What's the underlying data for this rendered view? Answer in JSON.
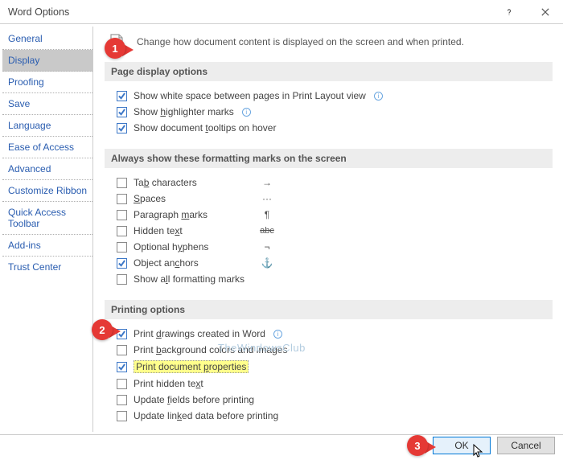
{
  "title": "Word Options",
  "header": "Change how document content is displayed on the screen and when printed.",
  "sidebar": {
    "items": [
      {
        "label": "General"
      },
      {
        "label": "Display"
      },
      {
        "label": "Proofing"
      },
      {
        "label": "Save"
      },
      {
        "label": "Language"
      },
      {
        "label": "Ease of Access"
      },
      {
        "label": "Advanced"
      },
      {
        "label": "Customize Ribbon"
      },
      {
        "label": "Quick Access Toolbar"
      },
      {
        "label": "Add-ins"
      },
      {
        "label": "Trust Center"
      }
    ]
  },
  "group1": {
    "title": "Page display options",
    "opt1": "Show white space between pages in Print Layout view",
    "opt2_a": "Show ",
    "opt2_u": "h",
    "opt2_b": "ighlighter marks",
    "opt3_a": "Show document ",
    "opt3_u": "t",
    "opt3_b": "ooltips on hover"
  },
  "group2": {
    "title": "Always show these formatting marks on the screen",
    "tab_a": "Ta",
    "tab_u": "b",
    "tab_b": " characters",
    "spaces_u": "S",
    "spaces_b": "paces",
    "para_a": "Paragraph ",
    "para_u": "m",
    "para_b": "arks",
    "hidden_a": "Hidden te",
    "hidden_u": "x",
    "hidden_b": "t",
    "hyphens_a": "Optional h",
    "hyphens_u": "y",
    "hyphens_b": "phens",
    "anchors_a": "Object an",
    "anchors_u": "c",
    "anchors_b": "hors",
    "all_a": "Show a",
    "all_u": "l",
    "all_b": "l formatting marks",
    "mark_tab": "→",
    "mark_dots": "···",
    "mark_para": "¶",
    "mark_abc": "abc",
    "mark_hyph": "¬",
    "mark_anchor": "⚓"
  },
  "group3": {
    "title": "Printing options",
    "drawings_a": "Print ",
    "drawings_u": "d",
    "drawings_b": "rawings created in Word",
    "bg_a": "Print ",
    "bg_u": "b",
    "bg_b": "ackground colors and images",
    "props_a": "Print document ",
    "props_u": "p",
    "props_b": "roperties",
    "hidden_a": "Print hidden te",
    "hidden_u": "x",
    "hidden_b": "t",
    "fields_a": "Update ",
    "fields_u": "f",
    "fields_b": "ields before printing",
    "linked_a": "Update lin",
    "linked_u": "k",
    "linked_b": "ed data before printing"
  },
  "footer": {
    "ok": "OK",
    "cancel": "Cancel"
  },
  "callouts": {
    "one": "1",
    "two": "2",
    "three": "3"
  },
  "watermark": "TheWindowsClub"
}
